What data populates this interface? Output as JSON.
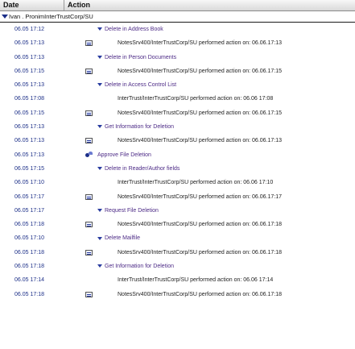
{
  "header": {
    "date_label": "Date",
    "action_label": "Action"
  },
  "group": {
    "title": "Ivan . PronimInterTrustCorp/SU"
  },
  "rows": [
    {
      "date": "06.05 17:12",
      "kind": "event",
      "text": "Delete in Address Book"
    },
    {
      "date": "06.05 17:13",
      "kind": "doc",
      "text": "NotesSrv400/InterTrustCorp/SU performed action on:  06.06.17:13"
    },
    {
      "date": "06.05 17:13",
      "kind": "event",
      "text": "Delete in Person Documents"
    },
    {
      "date": "06.05 17:15",
      "kind": "doc",
      "text": "NotesSrv400/InterTrustCorp/SU performed action on:  06.06.17:15"
    },
    {
      "date": "06.05 17:13",
      "kind": "event",
      "text": "Delete in Access Control List"
    },
    {
      "date": "06.05 17:08",
      "kind": "plain",
      "text": "InterTrust/InterTrustCorp/SU performed action on:  06.06 17:08"
    },
    {
      "date": "06.05 17:15",
      "kind": "doc",
      "text": "NotesSrv400/InterTrustCorp/SU performed action on:  06.06.17:15"
    },
    {
      "date": "06.05 17:13",
      "kind": "event",
      "text": "Get Information for Deletion"
    },
    {
      "date": "06.05 17:13",
      "kind": "doc",
      "text": "NotesSrv400/InterTrustCorp/SU performed action on:  06.06.17:13"
    },
    {
      "date": "06.05 17:13",
      "kind": "key",
      "text": "Approve File Deletion"
    },
    {
      "date": "06.05 17:15",
      "kind": "event",
      "text": "Delete in Reader/Author fields"
    },
    {
      "date": "06.05 17:10",
      "kind": "plain",
      "text": "InterTrust/InterTrustCorp/SU performed action on:  06.06 17:10"
    },
    {
      "date": "06.05 17:17",
      "kind": "doc",
      "text": "NotesSrv400/InterTrustCorp/SU performed action on:  06.06.17:17"
    },
    {
      "date": "06.05 17:17",
      "kind": "event",
      "text": "Request File Deletion"
    },
    {
      "date": "06.05 17:18",
      "kind": "doc",
      "text": "NotesSrv400/InterTrustCorp/SU performed action on:  06.06.17:18"
    },
    {
      "date": "06.05 17:10",
      "kind": "event",
      "text": "Delete Mailfile"
    },
    {
      "date": "06.05 17:18",
      "kind": "doc",
      "text": "NotesSrv400/InterTrustCorp/SU performed action on:  06.06.17:18"
    },
    {
      "date": "06.05 17:18",
      "kind": "event",
      "text": "Get Information for Deletion"
    },
    {
      "date": "06.05 17:14",
      "kind": "plain",
      "text": "InterTrust/InterTrustCorp/SU performed action on:  06.06 17:14"
    },
    {
      "date": "06.05 17:18",
      "kind": "doc",
      "text": "NotesSrv400/InterTrustCorp/SU performed action on:  06.06.17:18"
    }
  ]
}
